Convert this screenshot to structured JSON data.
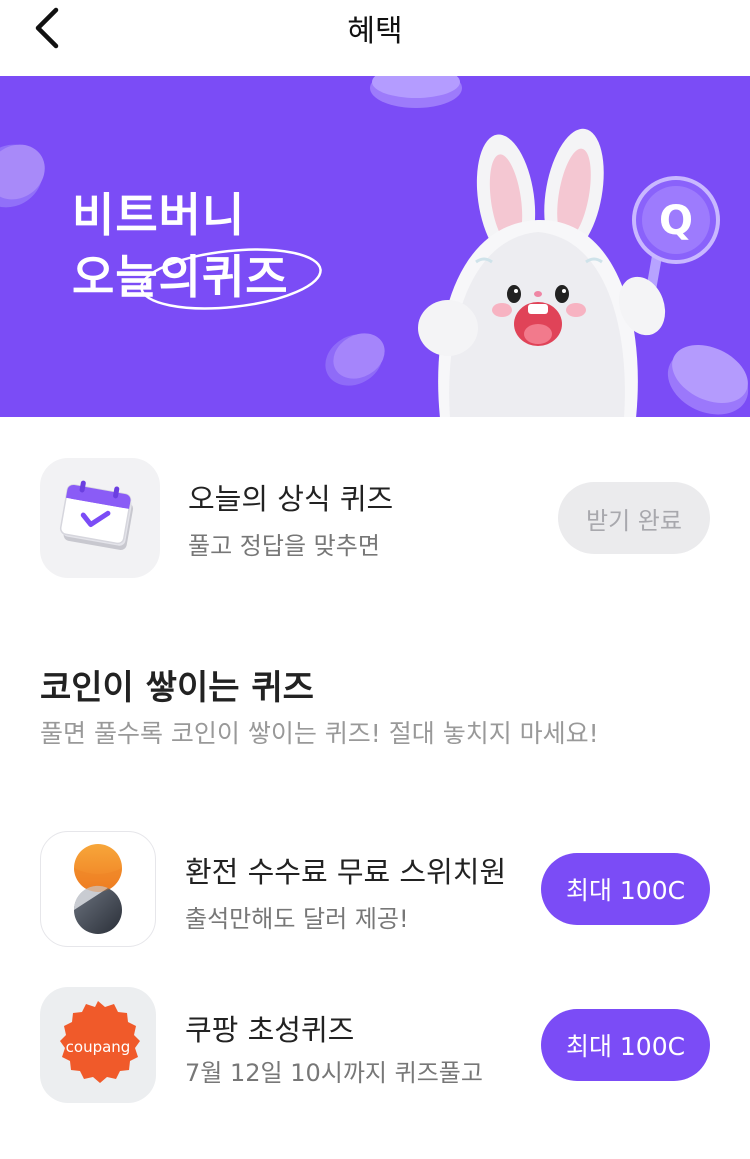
{
  "header": {
    "title": "혜택",
    "back_icon": "chevron-left-icon"
  },
  "banner": {
    "line1": "비트버니",
    "line2_prefix": "오늘의",
    "line2_highlight": "퀴즈",
    "mascot_badge": "Q",
    "background_color": "#7b4cf6"
  },
  "daily_quiz": {
    "title": "오늘의 상식 퀴즈",
    "subtitle": "풀고 정답을 맞추면",
    "button_label": "받기 완료",
    "icon": "calendar-check-icon"
  },
  "section": {
    "title": "코인이 쌓이는 퀴즈",
    "subtitle": "풀면 풀수록 코인이 쌓이는 퀴즈! 절대 놓치지 마세요!"
  },
  "quiz_items": [
    {
      "title": "환전 수수료 무료 스위치원",
      "subtitle": "출석만해도 달러 제공!",
      "button_label": "최대 100C",
      "icon": "switchone-logo-icon"
    },
    {
      "title": "쿠팡 초성퀴즈",
      "subtitle": "7월 12일 10시까지 퀴즈풀고",
      "button_label": "최대 100C",
      "icon": "coupang-logo-icon",
      "logo_text": "coupang"
    }
  ],
  "colors": {
    "accent": "#7b4cf6",
    "coupang": "#f05a2a",
    "orange": "#f59a2f"
  }
}
